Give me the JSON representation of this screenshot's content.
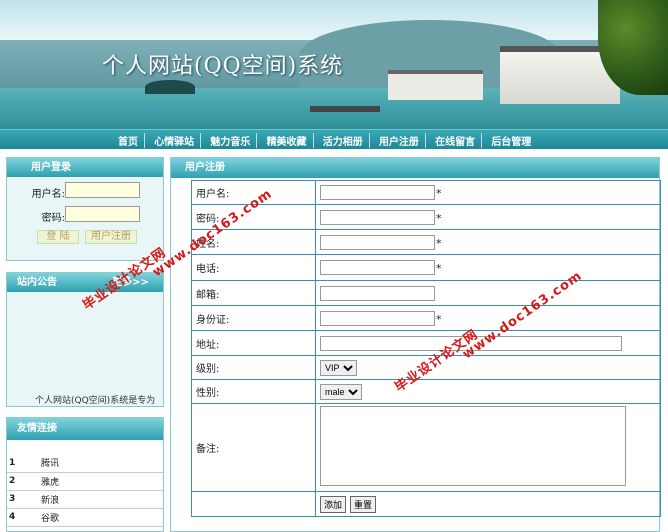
{
  "site": {
    "title": "个人网站(QQ空间)系统"
  },
  "nav": {
    "items": [
      "首页",
      "心情驿站",
      "魅力音乐",
      "精美收藏",
      "活力相册",
      "用户注册",
      "在线留言",
      "后台管理"
    ]
  },
  "login": {
    "title": "用户登录",
    "username_label": "用户名:",
    "password_label": "密码:",
    "login_button": "登 陆",
    "register_button": "用户注册"
  },
  "notice": {
    "title": "站内公告",
    "more": "更多>>",
    "scroll_text": "个人网站(QQ空间)系统是专为"
  },
  "links": {
    "title": "友情连接",
    "items": [
      {
        "no": "1",
        "name": "腾讯"
      },
      {
        "no": "2",
        "name": "雅虎"
      },
      {
        "no": "3",
        "name": "新浪"
      },
      {
        "no": "4",
        "name": "谷歌"
      }
    ]
  },
  "register": {
    "title": "用户注册",
    "fields": {
      "username": "用户名:",
      "password": "密码:",
      "realname": "姓名:",
      "phone": "电话:",
      "email": "邮箱:",
      "idcard": "身份证:",
      "address": "地址:",
      "level": "级别:",
      "gender": "性别:",
      "remark": "备注:"
    },
    "required_mark": "*",
    "level_value": "VIP",
    "gender_value": "male",
    "submit": "添加",
    "reset": "重置"
  },
  "watermark": {
    "text": "毕业设计论文网",
    "url": "www.doc163.com"
  },
  "colors": {
    "accent": "#2e9fb0",
    "header_text": "#ffffff",
    "watermark": "#d81818",
    "border": "#3a8fb0"
  }
}
